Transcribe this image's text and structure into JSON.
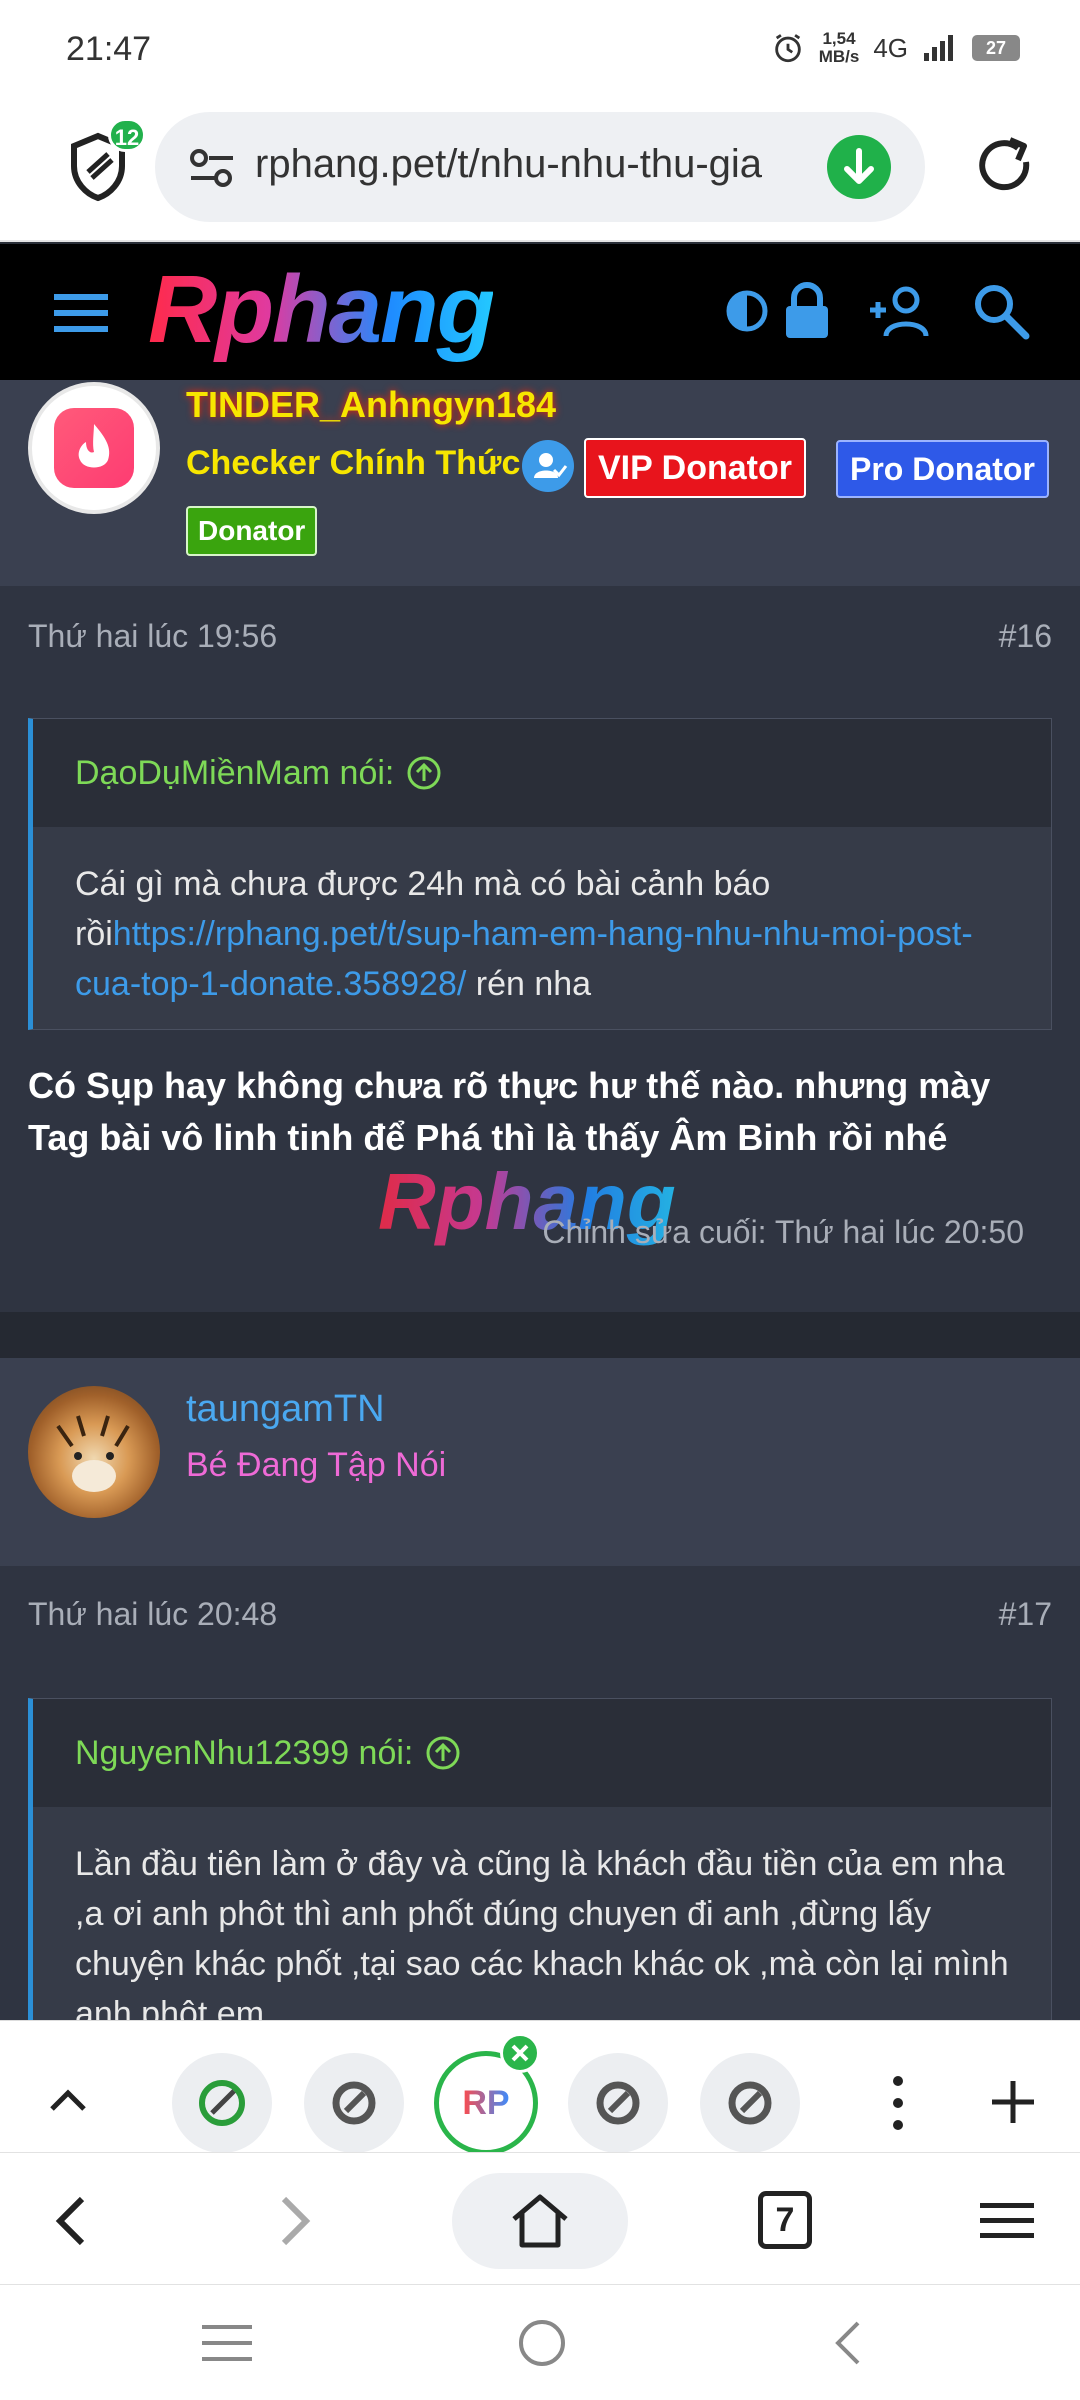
{
  "status_bar": {
    "time": "21:47",
    "speed_value": "1,54",
    "speed_unit": "MB/s",
    "network": "4G",
    "battery": "27"
  },
  "browser": {
    "shield_count": "12",
    "url": "rphang.pet/t/nhu-nhu-thu-gia"
  },
  "site": {
    "logo": "Rphang",
    "watermark": "Rphang"
  },
  "posts": [
    {
      "username": "TINDER_Anhngyn184",
      "title": "Checker Chính Thức",
      "badges": [
        "VIP Donator",
        "Pro Donator",
        "Donator"
      ],
      "date": "Thứ hai lúc 19:56",
      "number": "#16",
      "quote_author": "DạoDụMiềnMam nói:",
      "quote_text_1": "Cái gì mà chưa được 24h mà có bài cảnh báo rồi",
      "quote_link": "https://rphang.pet/t/sup-ham-em-hang-nhu-nhu-moi-post-cua-top-1-donate.358928/",
      "quote_text_2": " rén nha",
      "body": "Có Sụp hay không chưa rõ thực hư thế nào. nhưng mày Tag bài vô linh tinh để Phá thì là thấy Âm Binh rồi nhé",
      "edited": "Chỉnh sửa cuối: Thứ hai lúc 20:50"
    },
    {
      "username": "taungamTN",
      "title": "Bé Đang Tập Nói",
      "date": "Thứ hai lúc 20:48",
      "number": "#17",
      "quote_author": "NguyenNhu12399 nói:",
      "quote_text": "Lần đầu tiên làm ở đây và cũng là khách đầu tiền của em nha ,a ơi anh phôt thì anh phốt đúng chuyen đi anh ,đừng lấy chuyện khác phốt ,tại sao các khach khác ok ,mà còn lại mình anh phôt em"
    }
  ],
  "tabs": {
    "active_label": "RP",
    "tab_count": "7"
  },
  "colors": {
    "accent_blue": "#2b8fd6",
    "quote_author_green": "#7ed957",
    "vip_red": "#e8141c",
    "pro_blue": "#2e59e8",
    "donator_green": "#3aa40e",
    "username_yellow": "#f7e600",
    "username_blue": "#4aa8f0",
    "title_pink": "#ee6ad6"
  }
}
